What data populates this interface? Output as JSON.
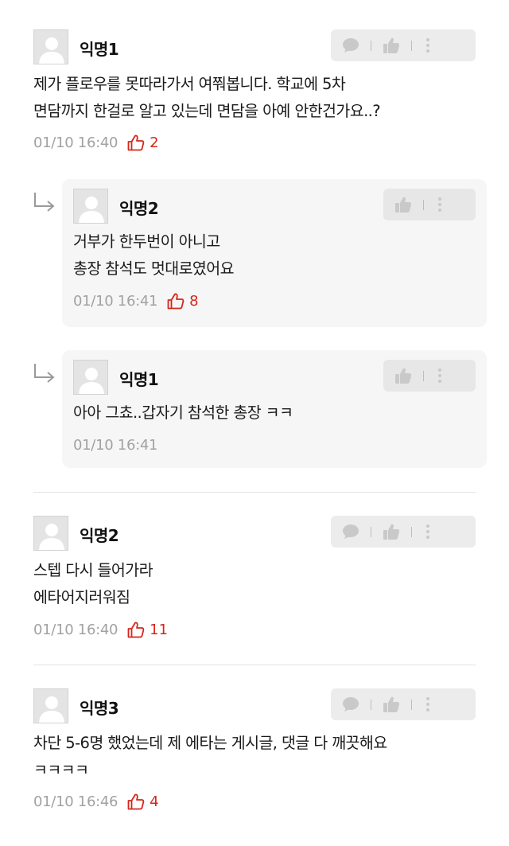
{
  "comments": [
    {
      "author": "익명1",
      "lines": [
        "제가 플로우를 못따라가서 여쭤봅니다. 학교에 5차",
        "면담까지 한걸로 알고 있는데 면담을 아예 안한건가요..?"
      ],
      "date": "01/10 16:40",
      "likes": "2",
      "replies": [
        {
          "author": "익명2",
          "lines": [
            "거부가 한두번이 아니고",
            "총장 참석도 멋대로였어요"
          ],
          "date": "01/10 16:41",
          "likes": "8"
        },
        {
          "author": "익명1",
          "lines": [
            "아아 그쵸..갑자기 참석한 총장 ㅋㅋ"
          ],
          "date": "01/10 16:41",
          "likes": ""
        }
      ]
    },
    {
      "author": "익명2",
      "lines": [
        "스텝 다시 들어가라",
        "에타어지러워짐"
      ],
      "date": "01/10 16:40",
      "likes": "11"
    },
    {
      "author": "익명3",
      "lines": [
        "차단 5-6명 했었는데 제 에타는 게시글, 댓글 다 깨끗해요",
        "ㅋㅋㅋㅋ"
      ],
      "date": "01/10 16:46",
      "likes": "4"
    }
  ],
  "icons": {
    "reply": "speech-bubble-icon",
    "vote": "thumbs-up-icon",
    "more": "more-vertical-icon",
    "liked": "thumbs-up-outline-icon",
    "nested": "reply-arrow-icon",
    "avatar": "default-avatar-icon"
  },
  "colors": {
    "like_accent": "#d6261c",
    "meta_gray": "#a2a2a2",
    "reply_bg": "#f6f6f6"
  }
}
